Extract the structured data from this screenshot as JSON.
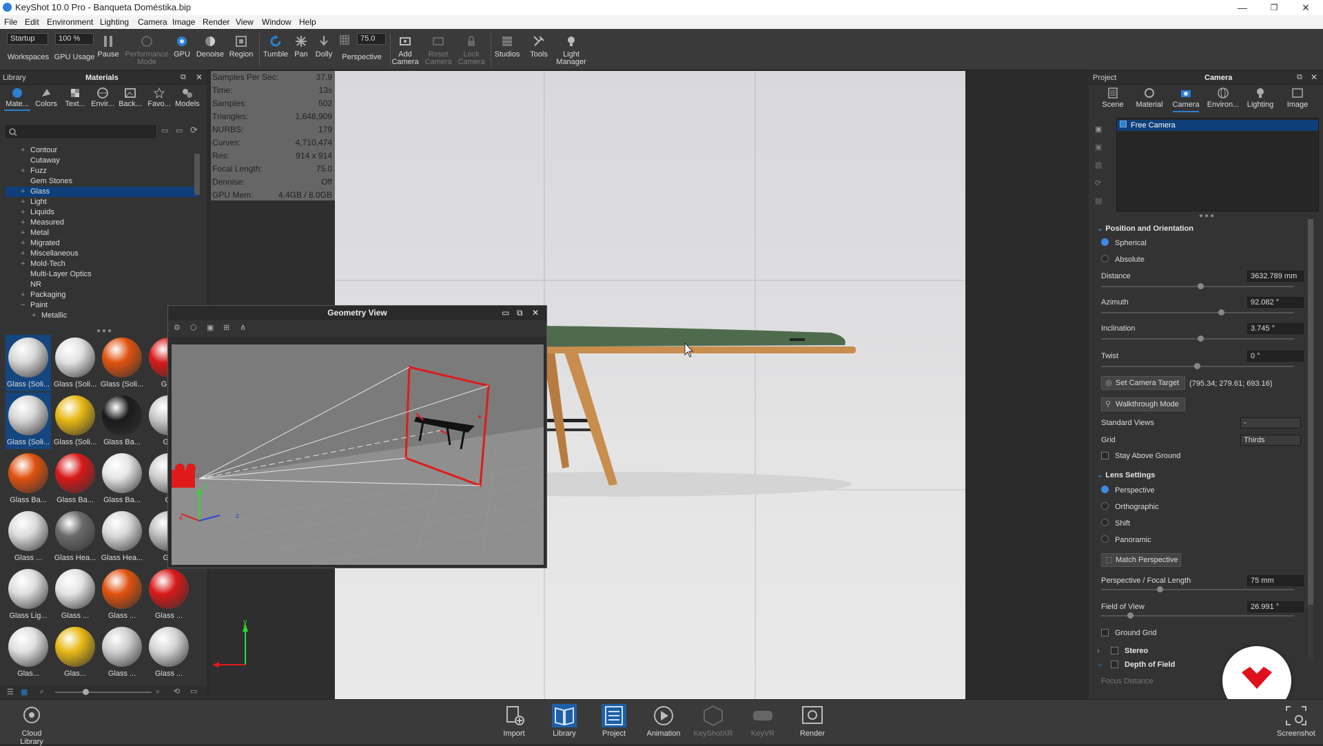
{
  "window": {
    "title": "KeyShot 10.0 Pro - Banqueta Doméstika.bip",
    "minimize": "—",
    "restore": "❐",
    "close": "✕"
  },
  "menu": [
    "File",
    "Edit",
    "Environment",
    "Lighting",
    "Camera",
    "Image",
    "Render",
    "View",
    "Window",
    "Help"
  ],
  "toolbar": {
    "workspace_value": "Startup",
    "gpu_usage_value": "100 %",
    "workspaces": "Workspaces",
    "gpu_usage": "GPU Usage",
    "pause": "Pause",
    "performance": "Performance",
    "mode": "Mode",
    "gpu": "GPU",
    "denoise": "Denoise",
    "region": "Region",
    "tumble": "Tumble",
    "pan": "Pan",
    "dolly": "Dolly",
    "perspective_value": "75.0",
    "perspective": "Perspective",
    "add": "Add",
    "reset": "Reset",
    "lock": "Lock",
    "camera": "Camera",
    "studios": "Studios",
    "tools": "Tools",
    "light": "Light",
    "manager": "Manager"
  },
  "library": {
    "title": "Library",
    "section": "Materials",
    "tabs": [
      "Mate...",
      "Colors",
      "Text...",
      "Envir...",
      "Back...",
      "Favo...",
      "Models"
    ],
    "tree": [
      {
        "label": "Contour",
        "exp": "+"
      },
      {
        "label": "Cutaway",
        "exp": ""
      },
      {
        "label": "Fuzz",
        "exp": "+"
      },
      {
        "label": "Gem Stones",
        "exp": ""
      },
      {
        "label": "Glass",
        "exp": "+",
        "selected": true
      },
      {
        "label": "Light",
        "exp": "+"
      },
      {
        "label": "Liquids",
        "exp": "+"
      },
      {
        "label": "Measured",
        "exp": "+"
      },
      {
        "label": "Metal",
        "exp": "+"
      },
      {
        "label": "Migrated",
        "exp": "+"
      },
      {
        "label": "Miscellaneous",
        "exp": "+"
      },
      {
        "label": "Mold-Tech",
        "exp": "+"
      },
      {
        "label": "Multi-Layer Optics",
        "exp": ""
      },
      {
        "label": "NR",
        "exp": ""
      },
      {
        "label": "Packaging",
        "exp": "+"
      },
      {
        "label": "Paint",
        "exp": "−"
      },
      {
        "label": "Metallic",
        "exp": "+",
        "indent": true
      }
    ],
    "thumbs": [
      [
        "Glass (Soli...",
        "#d8d8d8"
      ],
      [
        "Glass (Soli...",
        "#e2e2e2"
      ],
      [
        "Glass (Soli...",
        "#e0520f"
      ],
      [
        "Glas",
        "#d81818"
      ],
      [
        "Glass (Soli...",
        "#d6d6d6"
      ],
      [
        "Glass (Soli...",
        "#e8b814"
      ],
      [
        "Glass Ba...",
        "#1a1a1a"
      ],
      [
        "Gla",
        "#c9c9c9"
      ],
      [
        "Glass Ba...",
        "#e0520f"
      ],
      [
        "Glass Ba...",
        "#d81818"
      ],
      [
        "Glass Ba...",
        "#e6e6e6"
      ],
      [
        "Gl",
        "#cfcfcf"
      ],
      [
        "Glass ...",
        "#dcdcdc"
      ],
      [
        "Glass Hea...",
        "#6a6a6a"
      ],
      [
        "Glass Hea...",
        "#d9d9d9"
      ],
      [
        "Gla",
        "#bdbdbd"
      ],
      [
        "Glass Lig...",
        "#dedede"
      ],
      [
        "Glass ...",
        "#e4e4e4"
      ],
      [
        "Glass ...",
        "#e0520f"
      ],
      [
        "Glass ...",
        "#d81818"
      ],
      [
        "Glas...",
        "#e0e0e0"
      ],
      [
        "Glas...",
        "#e8b814"
      ],
      [
        "Glass ...",
        "#cfcfcf"
      ],
      [
        "Glass ...",
        "#d6d6d6"
      ]
    ]
  },
  "stats": [
    [
      "Samples Per Sec:",
      "37.9"
    ],
    [
      "Time:",
      "13s"
    ],
    [
      "Samples:",
      "502"
    ],
    [
      "Triangles:",
      "1,648,909"
    ],
    [
      "NURBS:",
      "179"
    ],
    [
      "Curves:",
      "4,710,474"
    ],
    [
      "Res:",
      "914 x 914"
    ],
    [
      "Focal Length:",
      "75.0"
    ],
    [
      "Denoise:",
      "Off"
    ],
    [
      "GPU Mem:",
      "4.4GB / 8.0GB"
    ]
  ],
  "geometry_view": {
    "title": "Geometry View",
    "axis_x": "x",
    "axis_y": "y",
    "axis_z": "z"
  },
  "viewport_axis": {
    "y": "y"
  },
  "project": {
    "title": "Project",
    "section": "Camera",
    "tabs": [
      "Scene",
      "Material",
      "Camera",
      "Environ...",
      "Lighting",
      "Image"
    ],
    "camera_item": "Free Camera",
    "pos_header": "Position and Orientation",
    "spherical": "Spherical",
    "absolute": "Absolute",
    "distance_label": "Distance",
    "distance_value": "3632.789 mm",
    "distance": 0.52,
    "azimuth_label": "Azimuth",
    "azimuth_value": "92.082 °",
    "azimuth": 0.63,
    "inclination_label": "Inclination",
    "inclination_value": "3.745 °",
    "inclination": 0.52,
    "twist_label": "Twist",
    "twist_value": "0 °",
    "twist": 0.5,
    "set_target": "Set Camera Target",
    "target_value": "(795.34; 279.61; 693.16)",
    "walkthrough": "Walkthrough Mode",
    "standard_views_label": "Standard Views",
    "standard_views_value": "-",
    "grid_label": "Grid",
    "grid_value": "Thirds",
    "stay_above": "Stay Above Ground",
    "lens_header": "Lens Settings",
    "perspective": "Perspective",
    "orthographic": "Orthographic",
    "shift": "Shift",
    "panoramic": "Panoramic",
    "match_perspective": "Match Perspective",
    "focal_label": "Perspective / Focal Length",
    "focal_value": "75 mm",
    "focal": 0.3,
    "fov_label": "Field of View",
    "fov_value": "26.991 °",
    "fov": 0.14,
    "ground_grid": "Ground Grid",
    "stereo": "Stereo",
    "dof": "Depth of Field",
    "focus_distance": "Focus Distance"
  },
  "bottom": {
    "cloud": "Cloud Library",
    "import": "Import",
    "library": "Library",
    "project": "Project",
    "animation": "Animation",
    "keyshotxr": "KeyShotXR",
    "keyvr": "KeyVR",
    "render": "Render",
    "screenshot": "Screenshot"
  },
  "colors": {
    "accent": "#2b7fd4",
    "selection": "#0f3f7a",
    "camera_red": "#e01a1a",
    "cushion": "#4f6b4d",
    "wood": "#c98d4e"
  }
}
